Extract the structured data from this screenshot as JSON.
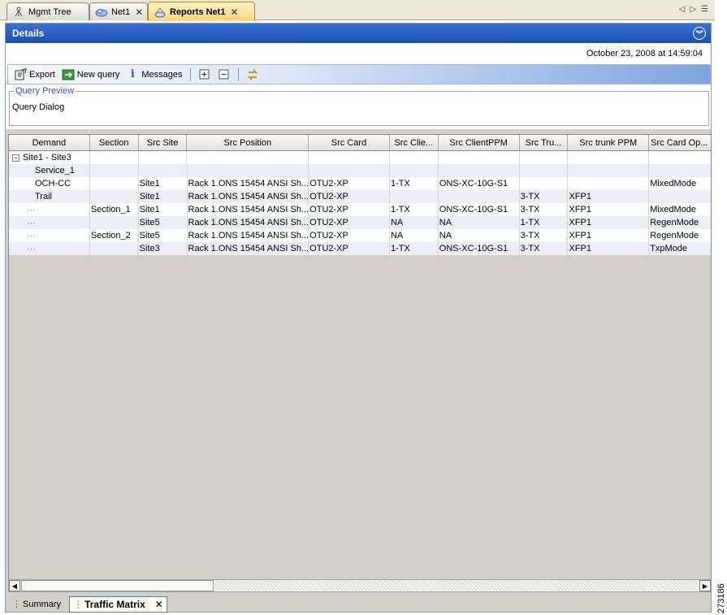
{
  "tabs": [
    {
      "label": "Mgmt Tree",
      "icon": "mgmt-tree-icon",
      "closable": false,
      "active": false
    },
    {
      "label": "Net1",
      "icon": "network-cloud-icon",
      "closable": true,
      "active": false
    },
    {
      "label": "Reports Net1",
      "icon": "reports-icon",
      "closable": true,
      "active": true
    }
  ],
  "details": {
    "title": "Details",
    "date": "October 23, 2008 at 14:59:04"
  },
  "toolbar": {
    "export_label": "Export",
    "new_query_label": "New query",
    "messages_label": "Messages"
  },
  "query_preview": {
    "legend": "Query Preview",
    "text": "Query Dialog"
  },
  "table": {
    "columns": [
      "Demand",
      "Section",
      "Src Site",
      "Src Position",
      "Src Card",
      "Src Clie...",
      "Src ClientPPM",
      "Src Tru...",
      "Src trunk PPM",
      "Src Card Op..."
    ],
    "rows": [
      {
        "demand": "Site1 - Site3",
        "section": "",
        "site": "",
        "position": "",
        "card": "",
        "client": "",
        "clientppm": "",
        "trunk": "",
        "trunkppm": "",
        "mode": ""
      },
      {
        "demand": "Service_1",
        "section": "",
        "site": "",
        "position": "",
        "card": "",
        "client": "",
        "clientppm": "",
        "trunk": "",
        "trunkppm": "",
        "mode": ""
      },
      {
        "demand": "OCH-CC",
        "section": "",
        "site": "Site1",
        "position": "Rack 1.ONS 15454 ANSI Sh...",
        "card": "OTU2-XP",
        "client": "1-TX",
        "clientppm": "ONS-XC-10G-S1",
        "trunk": "",
        "trunkppm": "",
        "mode": "MixedMode"
      },
      {
        "demand": "Trail",
        "section": "",
        "site": "Site1",
        "position": "Rack 1.ONS 15454 ANSI Sh...",
        "card": "OTU2-XP",
        "client": "",
        "clientppm": "",
        "trunk": "3-TX",
        "trunkppm": "XFP1",
        "mode": ""
      },
      {
        "demand": "",
        "section": "Section_1",
        "site": "Site1",
        "position": "Rack 1.ONS 15454 ANSI Sh...",
        "card": "OTU2-XP",
        "client": "1-TX",
        "clientppm": "ONS-XC-10G-S1",
        "trunk": "3-TX",
        "trunkppm": "XFP1",
        "mode": "MixedMode"
      },
      {
        "demand": "",
        "section": "",
        "site": "Site5",
        "position": "Rack 1.ONS 15454 ANSI Sh...",
        "card": "OTU2-XP",
        "client": "NA",
        "clientppm": "NA",
        "trunk": "1-TX",
        "trunkppm": "XFP1",
        "mode": "RegenMode"
      },
      {
        "demand": "",
        "section": "Section_2",
        "site": "Site5",
        "position": "Rack 1.ONS 15454 ANSI Sh...",
        "card": "OTU2-XP",
        "client": "NA",
        "clientppm": "NA",
        "trunk": "3-TX",
        "trunkppm": "XFP1",
        "mode": "RegenMode"
      },
      {
        "demand": "",
        "section": "",
        "site": "Site3",
        "position": "Rack 1.ONS 15454 ANSI Sh...",
        "card": "OTU2-XP",
        "client": "1-TX",
        "clientppm": "ONS-XC-10G-S1",
        "trunk": "3-TX",
        "trunkppm": "XFP1",
        "mode": "TxpMode"
      }
    ]
  },
  "bottom_tabs": [
    {
      "label": "Summary",
      "active": false
    },
    {
      "label": "Traffic Matrix",
      "active": true
    }
  ],
  "side_code": "273186",
  "colors": {
    "accent_blue": "#1e4fae",
    "active_tab": "#ffd67a",
    "alt_row": "#e8eff6"
  }
}
